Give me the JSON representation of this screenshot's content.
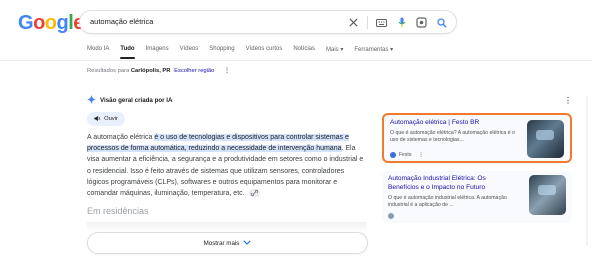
{
  "logo": {
    "text": "Google",
    "letters": [
      "G",
      "o",
      "o",
      "g",
      "l",
      "e"
    ],
    "colors": [
      "#4285F4",
      "#EA4335",
      "#FBBC05",
      "#4285F4",
      "#34A853",
      "#EA4335"
    ]
  },
  "search": {
    "query": "automação elétrica"
  },
  "tabs": [
    {
      "label": "Modo IA",
      "active": false
    },
    {
      "label": "Tudo",
      "active": true
    },
    {
      "label": "Imagens",
      "active": false
    },
    {
      "label": "Vídeos",
      "active": false
    },
    {
      "label": "Shopping",
      "active": false
    },
    {
      "label": "Vídeos curtos",
      "active": false
    },
    {
      "label": "Notícias",
      "active": false
    },
    {
      "label": "Mais",
      "active": false
    },
    {
      "label": "Ferramentas",
      "active": false
    }
  ],
  "location": {
    "prefix": "Resultados para",
    "place": "Carlópolis, PR",
    "change_link": "Escolher região"
  },
  "ai_overview": {
    "heading": "Visão geral criada por IA",
    "listen_label": "Ouvir",
    "intro": "A automação elétrica ",
    "highlight": "é o uso de tecnologias e dispositivos para controlar sistemas e processos de forma automática, reduzindo a necessidade de intervenção humana",
    "rest": ". Ela visa aumentar a eficiência, a segurança e a produtividade em setores como o industrial e o residencial. Isso é feito através de sistemas que utilizam sensores, controladores lógicos programáveis (CLPs), softwares e outros equipamentos para monitorar e comandar máquinas, iluminação, temperatura, etc.",
    "section_heading": "Em residências",
    "show_more_label": "Mostrar mais"
  },
  "sources": [
    {
      "title": "Automação elétrica | Festo BR",
      "snippet": "O que é automação elétrica? A automação elétrica é o uso de sistemas e tecnologias...",
      "source": "Festo",
      "highlighted": true
    },
    {
      "title": "Automação Industrial Elétrica: Os Benefícios e o Impacto no Futuro",
      "snippet": "O que é automação industrial elétrica. A automação industrial é a aplicação de ...",
      "source": "",
      "highlighted": false
    }
  ],
  "colors": {
    "highlight_border": "#f27b2b",
    "link_blue": "#1a0dab",
    "highlight_bg": "#d3e3fd"
  }
}
